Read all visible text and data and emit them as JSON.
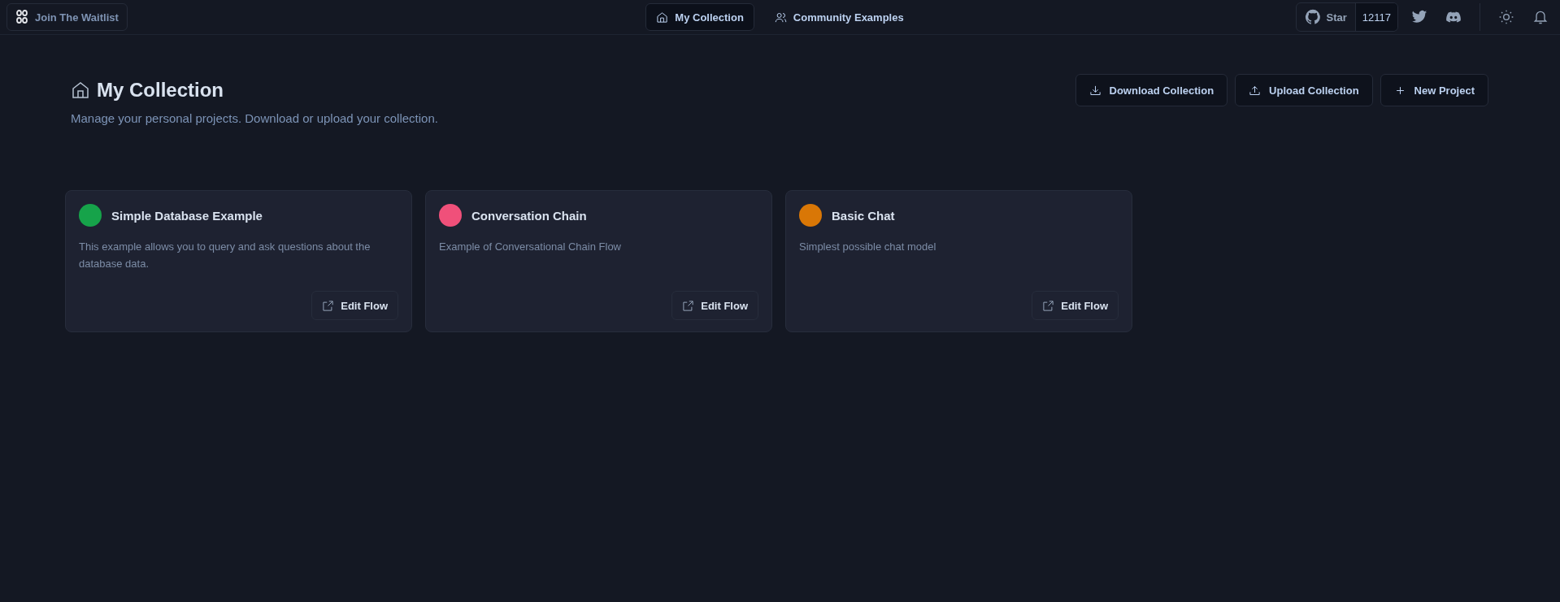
{
  "topbar": {
    "waitlist": "Join The Waitlist",
    "tabs": [
      {
        "label": "My Collection",
        "kind": "home",
        "selected": true
      },
      {
        "label": "Community Examples",
        "kind": "users",
        "selected": false
      }
    ],
    "github": {
      "label": "Star",
      "count": "12117"
    }
  },
  "header": {
    "title": "My Collection",
    "subtitle": "Manage your personal projects. Download or upload your collection.",
    "buttons": [
      {
        "label": "Download Collection",
        "kind": "download"
      },
      {
        "label": "Upload Collection",
        "kind": "upload"
      },
      {
        "label": "New Project",
        "kind": "create"
      }
    ]
  },
  "projects": [
    {
      "name": "Simple Database Example",
      "description": "This example allows you to query and ask questions about the database data.",
      "color": "#16a34a",
      "button": "Edit Flow"
    },
    {
      "name": "Conversation Chain",
      "description": "Example of Conversational Chain Flow",
      "color": "#f0507a",
      "button": "Edit Flow"
    },
    {
      "name": "Basic Chat",
      "description": "Simplest possible chat model",
      "color": "#d97706",
      "button": "Edit Flow"
    }
  ]
}
